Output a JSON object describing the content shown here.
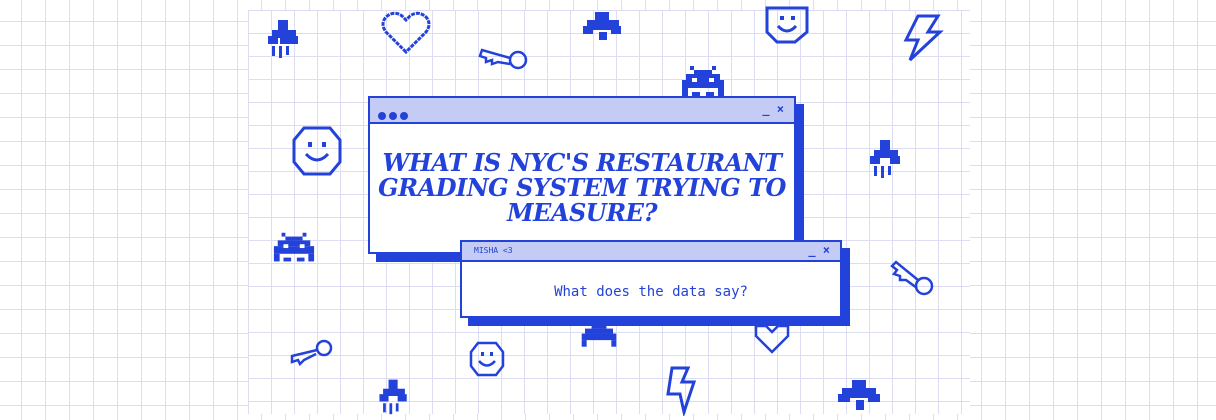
{
  "main_window": {
    "title": "WHAT IS NYC'S RESTAURANT GRADING SYSTEM TRYING TO MEASURE?",
    "controls": "_ ×"
  },
  "sub_window": {
    "tab_label": "MISHA <3",
    "controls": "_ ×",
    "text": "What does the data say?"
  },
  "colors": {
    "accent": "#2342d9",
    "bar_fill": "#c4cbf5",
    "grid": "#d9ddf5"
  },
  "decorations": [
    "rocket-icon",
    "heart-icon",
    "key-icon",
    "ufo-icon",
    "smiley-icon",
    "lightning-icon",
    "space-invader-icon"
  ]
}
